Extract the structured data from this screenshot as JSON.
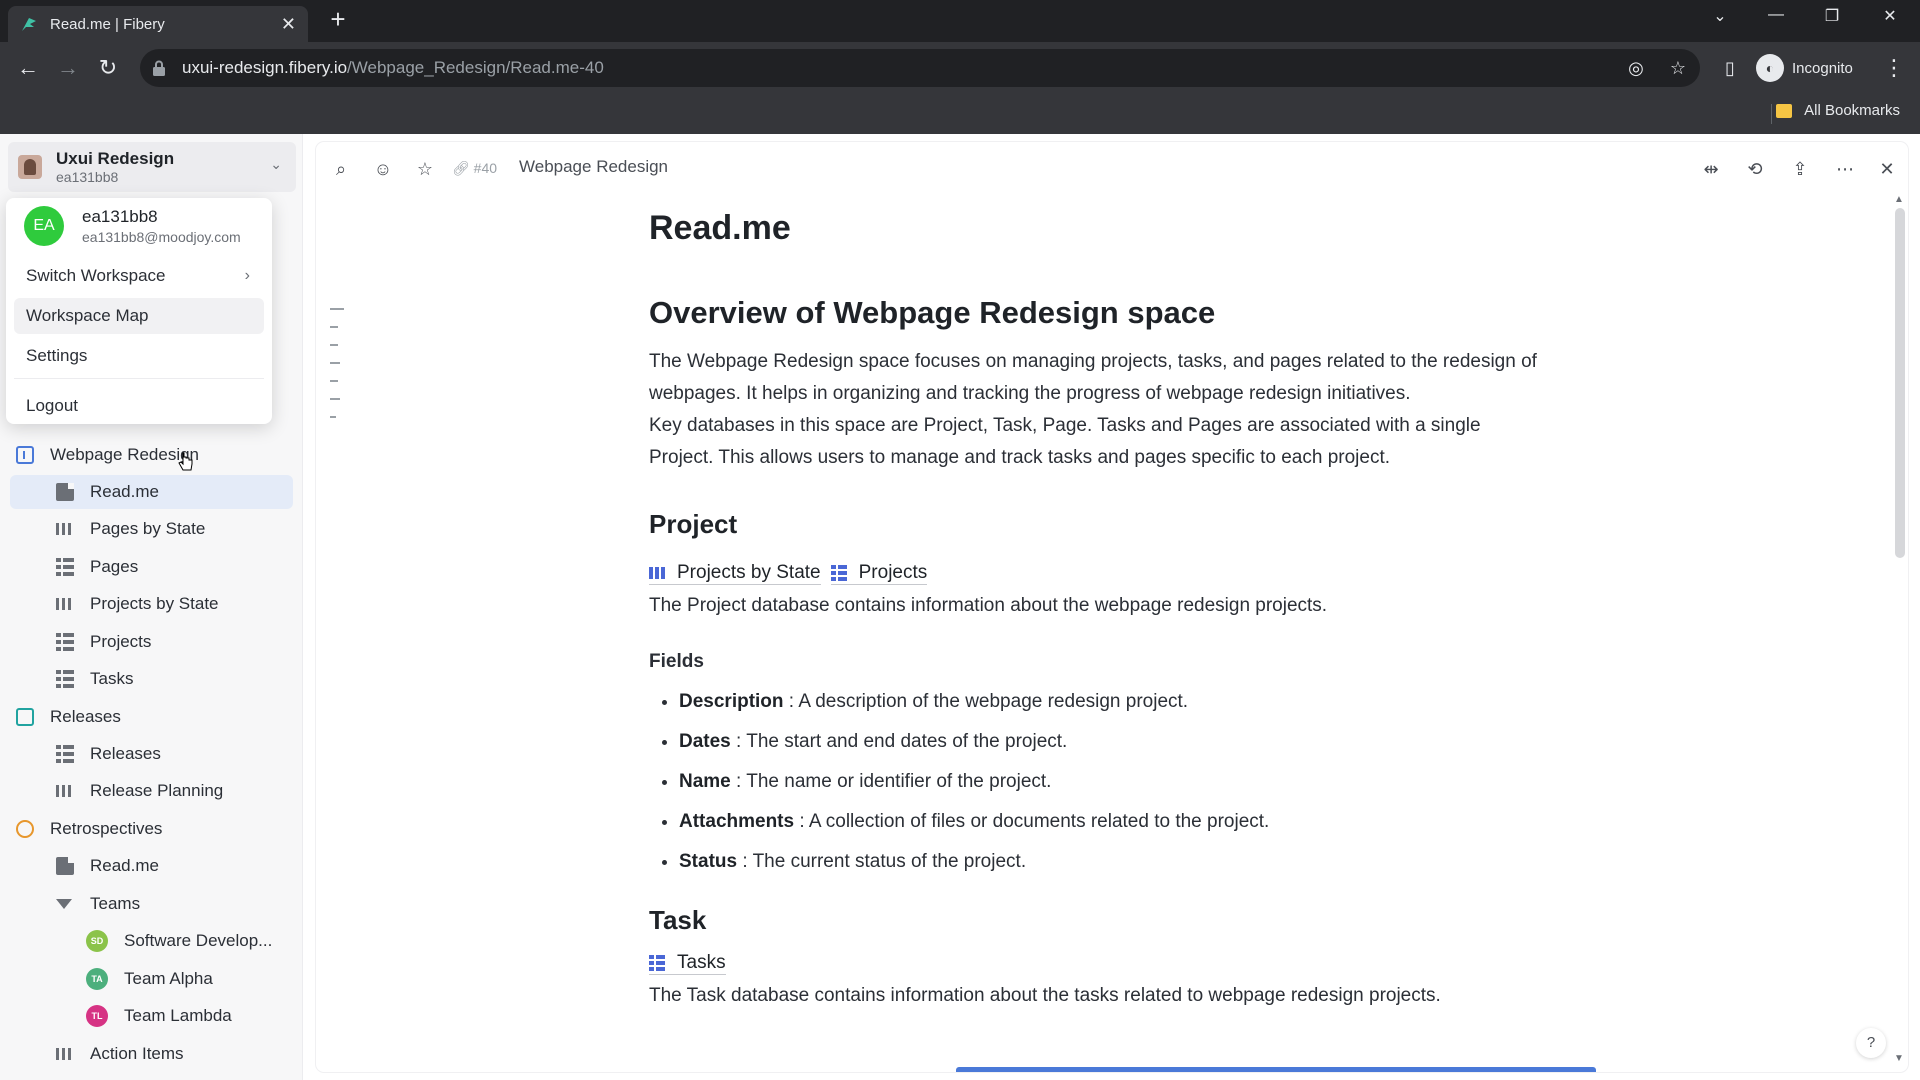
{
  "browser": {
    "tab_title": "Read.me | Fibery",
    "url_host": "uxui-redesign.fibery.io",
    "url_path": "/Webpage_Redesign/Read.me-40",
    "profile_label": "Incognito",
    "bookmarks_label": "All Bookmarks"
  },
  "workspace": {
    "name": "Uxui Redesign",
    "id": "ea131bb8"
  },
  "menu": {
    "user_initials": "EA",
    "user_name": "ea131bb8",
    "user_email": "ea131bb8@moodjoy.com",
    "items": [
      {
        "label": "Switch Workspace"
      },
      {
        "label": "Workspace Map"
      },
      {
        "label": "Settings"
      },
      {
        "label": "Logout"
      }
    ]
  },
  "sidebar": {
    "items": [
      {
        "label": "Webpage Redesign"
      },
      {
        "label": "Read.me"
      },
      {
        "label": "Pages by State"
      },
      {
        "label": "Pages"
      },
      {
        "label": "Projects by State"
      },
      {
        "label": "Projects"
      },
      {
        "label": "Tasks"
      },
      {
        "label": "Releases"
      },
      {
        "label": "Releases"
      },
      {
        "label": "Release Planning"
      },
      {
        "label": "Retrospectives"
      },
      {
        "label": "Read.me"
      },
      {
        "label": "Teams"
      },
      {
        "label": "Software Develop...",
        "initials": "SD",
        "color": "#8bc34a"
      },
      {
        "label": "Team Alpha",
        "initials": "TA",
        "color": "#4caf7d"
      },
      {
        "label": "Team Lambda",
        "initials": "TL",
        "color": "#d63384"
      },
      {
        "label": "Action Items"
      }
    ]
  },
  "toolbar": {
    "entity_id": "#40",
    "breadcrumb": "Webpage Redesign"
  },
  "doc": {
    "title": "Read.me",
    "overview_heading": "Overview of Webpage Redesign space",
    "overview_p1": "The Webpage Redesign space focuses on managing projects, tasks, and pages related to the redesign of webpages. It helps in organizing and tracking the progress of webpage redesign initiatives.",
    "overview_p2": "Key databases in this space are Project, Task, Page. Tasks and Pages are associated with a single Project. This allows users to manage and track tasks and pages specific to each project.",
    "project_heading": "Project",
    "project_link1": "Projects by State",
    "project_link2": "Projects",
    "project_desc": "The Project database contains information about the webpage redesign projects.",
    "fields_heading": "Fields",
    "fields": [
      {
        "name": "Description",
        "desc": " : A description of the webpage redesign project."
      },
      {
        "name": "Dates",
        "desc": " : The start and end dates of the project."
      },
      {
        "name": "Name",
        "desc": " : The name or identifier of the project."
      },
      {
        "name": "Attachments",
        "desc": " : A collection of files or documents related to the project."
      },
      {
        "name": "Status",
        "desc": " : The current status of the project."
      }
    ],
    "task_heading": "Task",
    "task_link": "Tasks",
    "task_desc": "The Task database contains information about the tasks related to webpage redesign projects."
  },
  "help_label": "?"
}
